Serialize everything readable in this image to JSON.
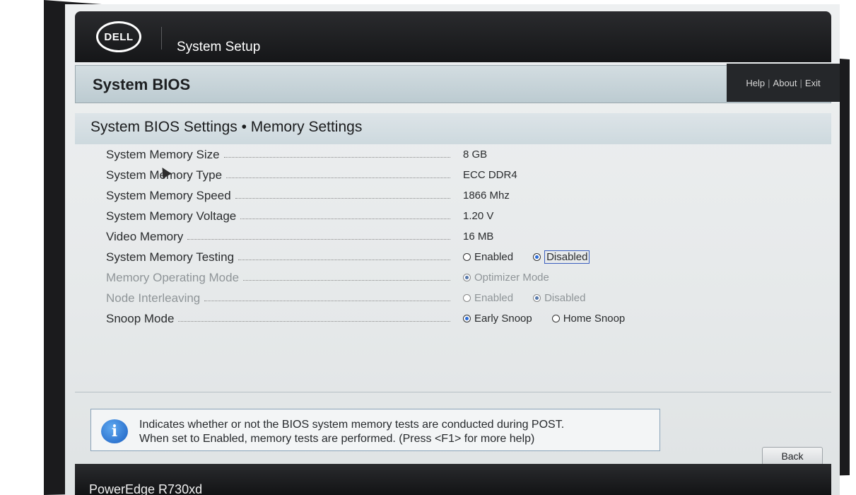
{
  "header": {
    "logo_text": "DELL",
    "app_title": "System Setup"
  },
  "bios": {
    "title": "System BIOS",
    "links": [
      "Help",
      "About",
      "Exit"
    ]
  },
  "section": {
    "title": "System BIOS Settings • Memory Settings"
  },
  "settings": [
    {
      "label": "System Memory Size",
      "value": "8 GB"
    },
    {
      "label": "System Memory Type",
      "value": "ECC DDR4"
    },
    {
      "label": "System Memory Speed",
      "value": "1866 Mhz"
    },
    {
      "label": "System Memory Voltage",
      "value": "1.20 V"
    },
    {
      "label": "Video Memory",
      "value": "16 MB"
    },
    {
      "label": "System Memory Testing",
      "options": [
        "Enabled",
        "Disabled"
      ],
      "selected": "Disabled"
    },
    {
      "label": "Memory Operating Mode",
      "options": [
        "Optimizer Mode"
      ],
      "selected": "Optimizer Mode"
    },
    {
      "label": "Node Interleaving",
      "options": [
        "Enabled",
        "Disabled"
      ],
      "selected": "Disabled"
    },
    {
      "label": "Snoop Mode",
      "options": [
        "Early Snoop",
        "Home Snoop"
      ],
      "selected": "Early Snoop"
    }
  ],
  "help": {
    "line1": "Indicates whether or not the BIOS system memory tests are conducted during POST.",
    "line2": "When set to Enabled, memory tests are performed. (Press <F1> for more help)"
  },
  "buttons": {
    "back_label": "Back"
  },
  "footer": {
    "model": "PowerEdge R730xd"
  }
}
